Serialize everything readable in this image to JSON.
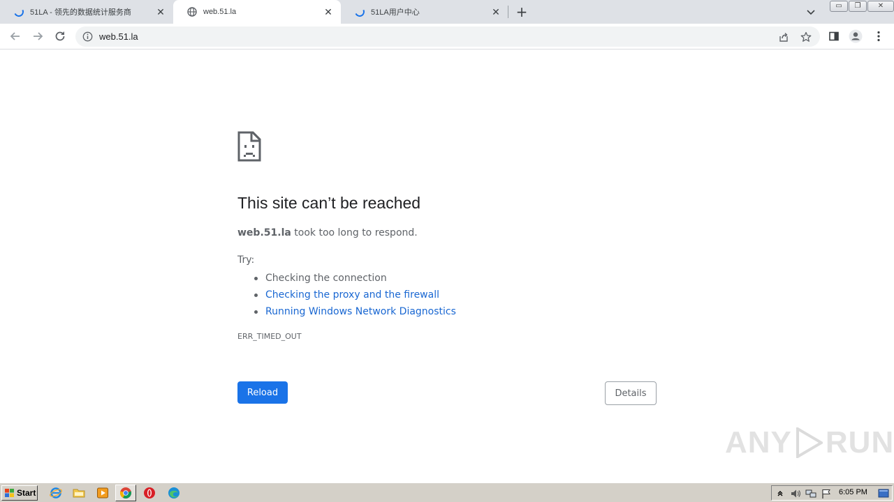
{
  "browser": {
    "tabs": [
      {
        "title": "51LA - 领先的数据统计服务商",
        "favicon": "loading-spinner-icon",
        "active": false
      },
      {
        "title": "web.51.la",
        "favicon": "globe-icon",
        "active": true
      },
      {
        "title": "51LA用户中心",
        "favicon": "loading-spinner-icon",
        "active": false
      }
    ],
    "new_tab_symbol": "+",
    "close_symbol": "✕",
    "window_controls": {
      "minimize": "▭",
      "restore": "❐",
      "close": "✕"
    },
    "address_bar": {
      "url": "web.51.la"
    }
  },
  "error_page": {
    "icon": "sad-page-icon",
    "heading": "This site can’t be reached",
    "summary_host": "web.51.la",
    "summary_text": " took too long to respond.",
    "try_label": "Try:",
    "suggestions": [
      {
        "text": "Checking the connection",
        "is_link": false
      },
      {
        "text": "Checking the proxy and the firewall",
        "is_link": true
      },
      {
        "text": "Running Windows Network Diagnostics",
        "is_link": true
      }
    ],
    "error_code": "ERR_TIMED_OUT",
    "reload_label": "Reload",
    "details_label": "Details",
    "colors": {
      "primary": "#1a73e8",
      "link": "#1967d2",
      "text": "#5f6368",
      "heading": "#202124"
    }
  },
  "watermark": {
    "left": "ANY",
    "right": "RUN"
  },
  "taskbar": {
    "start_label": "Start",
    "quick_launch": [
      "ie-icon",
      "folder-icon",
      "media-player-icon",
      "chrome-icon",
      "opera-icon",
      "edge-icon"
    ],
    "clock": "6:05 PM"
  }
}
